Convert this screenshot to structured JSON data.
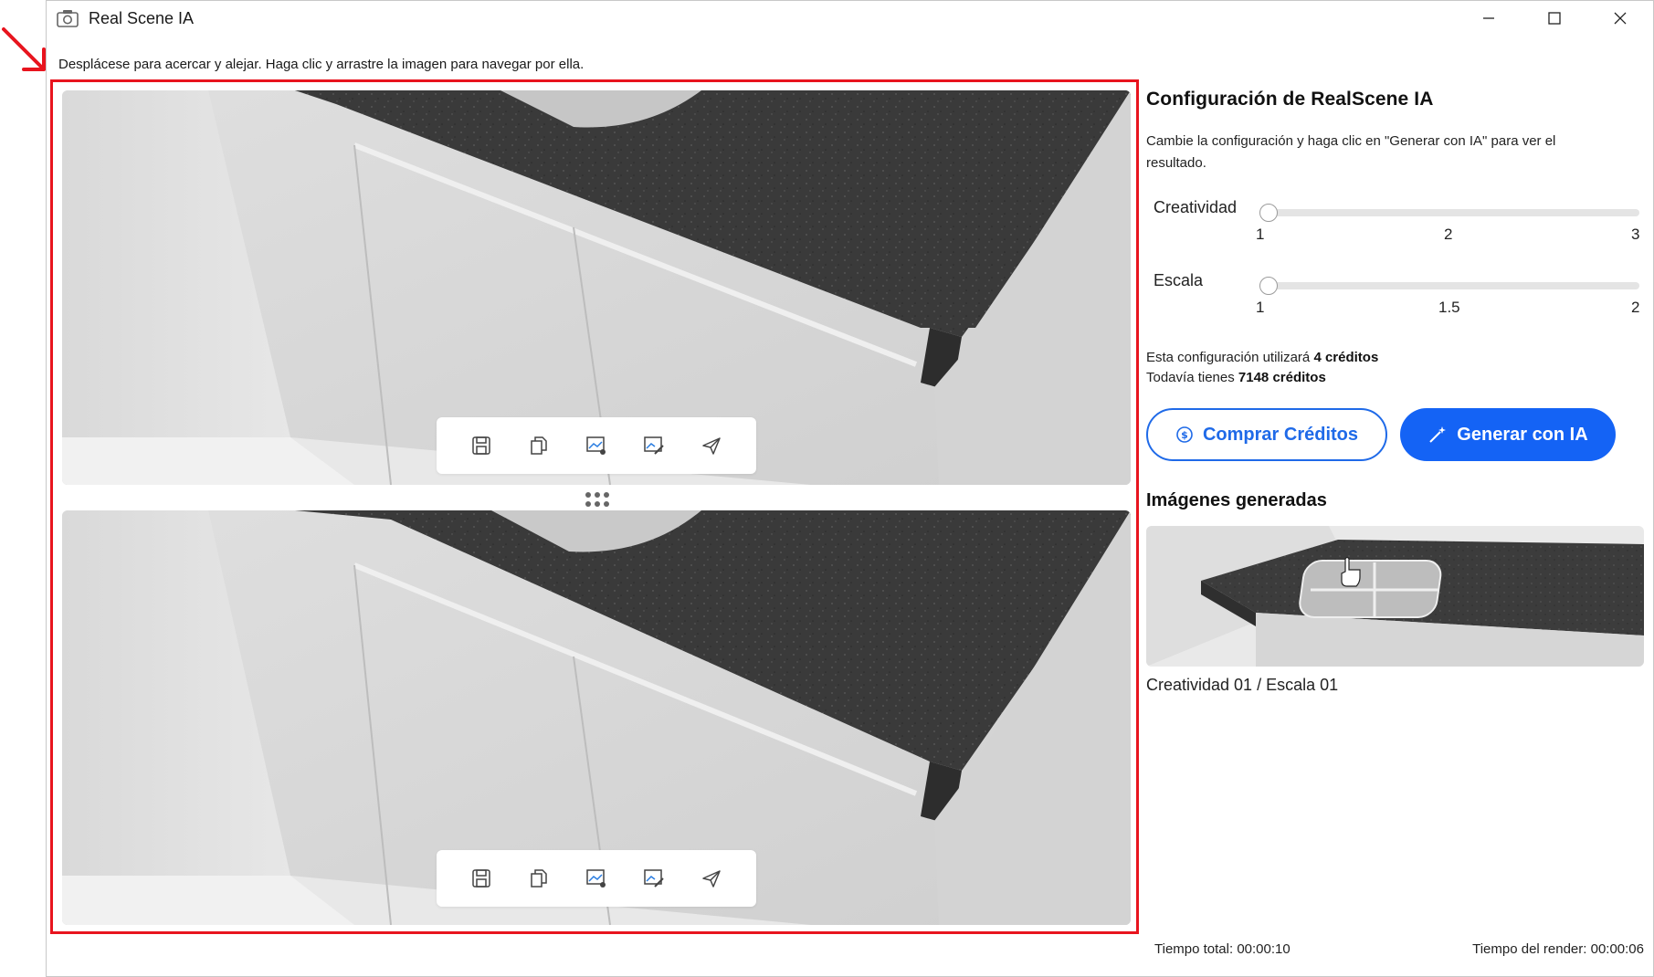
{
  "window": {
    "title": "Real Scene IA",
    "icons": [
      "camera-icon",
      "minimize-icon",
      "maximize-icon",
      "close-icon"
    ]
  },
  "instructions": "Desplácese para acercar y alejar. Haga clic y arrastre la imagen para navegar por ella.",
  "viewer": {
    "toolbar_icons": [
      "save-icon",
      "copy-icon",
      "image-export-icon",
      "image-edit-icon",
      "send-icon"
    ]
  },
  "settings": {
    "title": "Configuración de RealScene IA",
    "description": "Cambie la configuración y haga clic en \"Generar con IA\" para ver el resultado.",
    "creatividad": {
      "label": "Creatividad",
      "value": 1,
      "min": 1,
      "max": 3,
      "ticks": [
        "1",
        "2",
        "3"
      ]
    },
    "escala": {
      "label": "Escala",
      "value": 1,
      "min": 1,
      "max": 2,
      "ticks": [
        "1",
        "1.5",
        "2"
      ]
    },
    "credits_line1_prefix": "Esta configuración utilizará ",
    "credits_line1_value": "4 créditos",
    "credits_line2_prefix": "Todavía tienes ",
    "credits_line2_value": "7148 créditos",
    "buy_button": "Comprar Créditos",
    "generate_button": "Generar con IA"
  },
  "generated": {
    "title": "Imágenes generadas",
    "items": [
      {
        "caption": "Creatividad 01 / Escala 01"
      }
    ]
  },
  "footer": {
    "total_time": "Tiempo total: 00:00:10",
    "render_time": "Tiempo del render: 00:00:06"
  },
  "colors": {
    "accent": "#1463f5",
    "highlight": "#e8141e"
  }
}
